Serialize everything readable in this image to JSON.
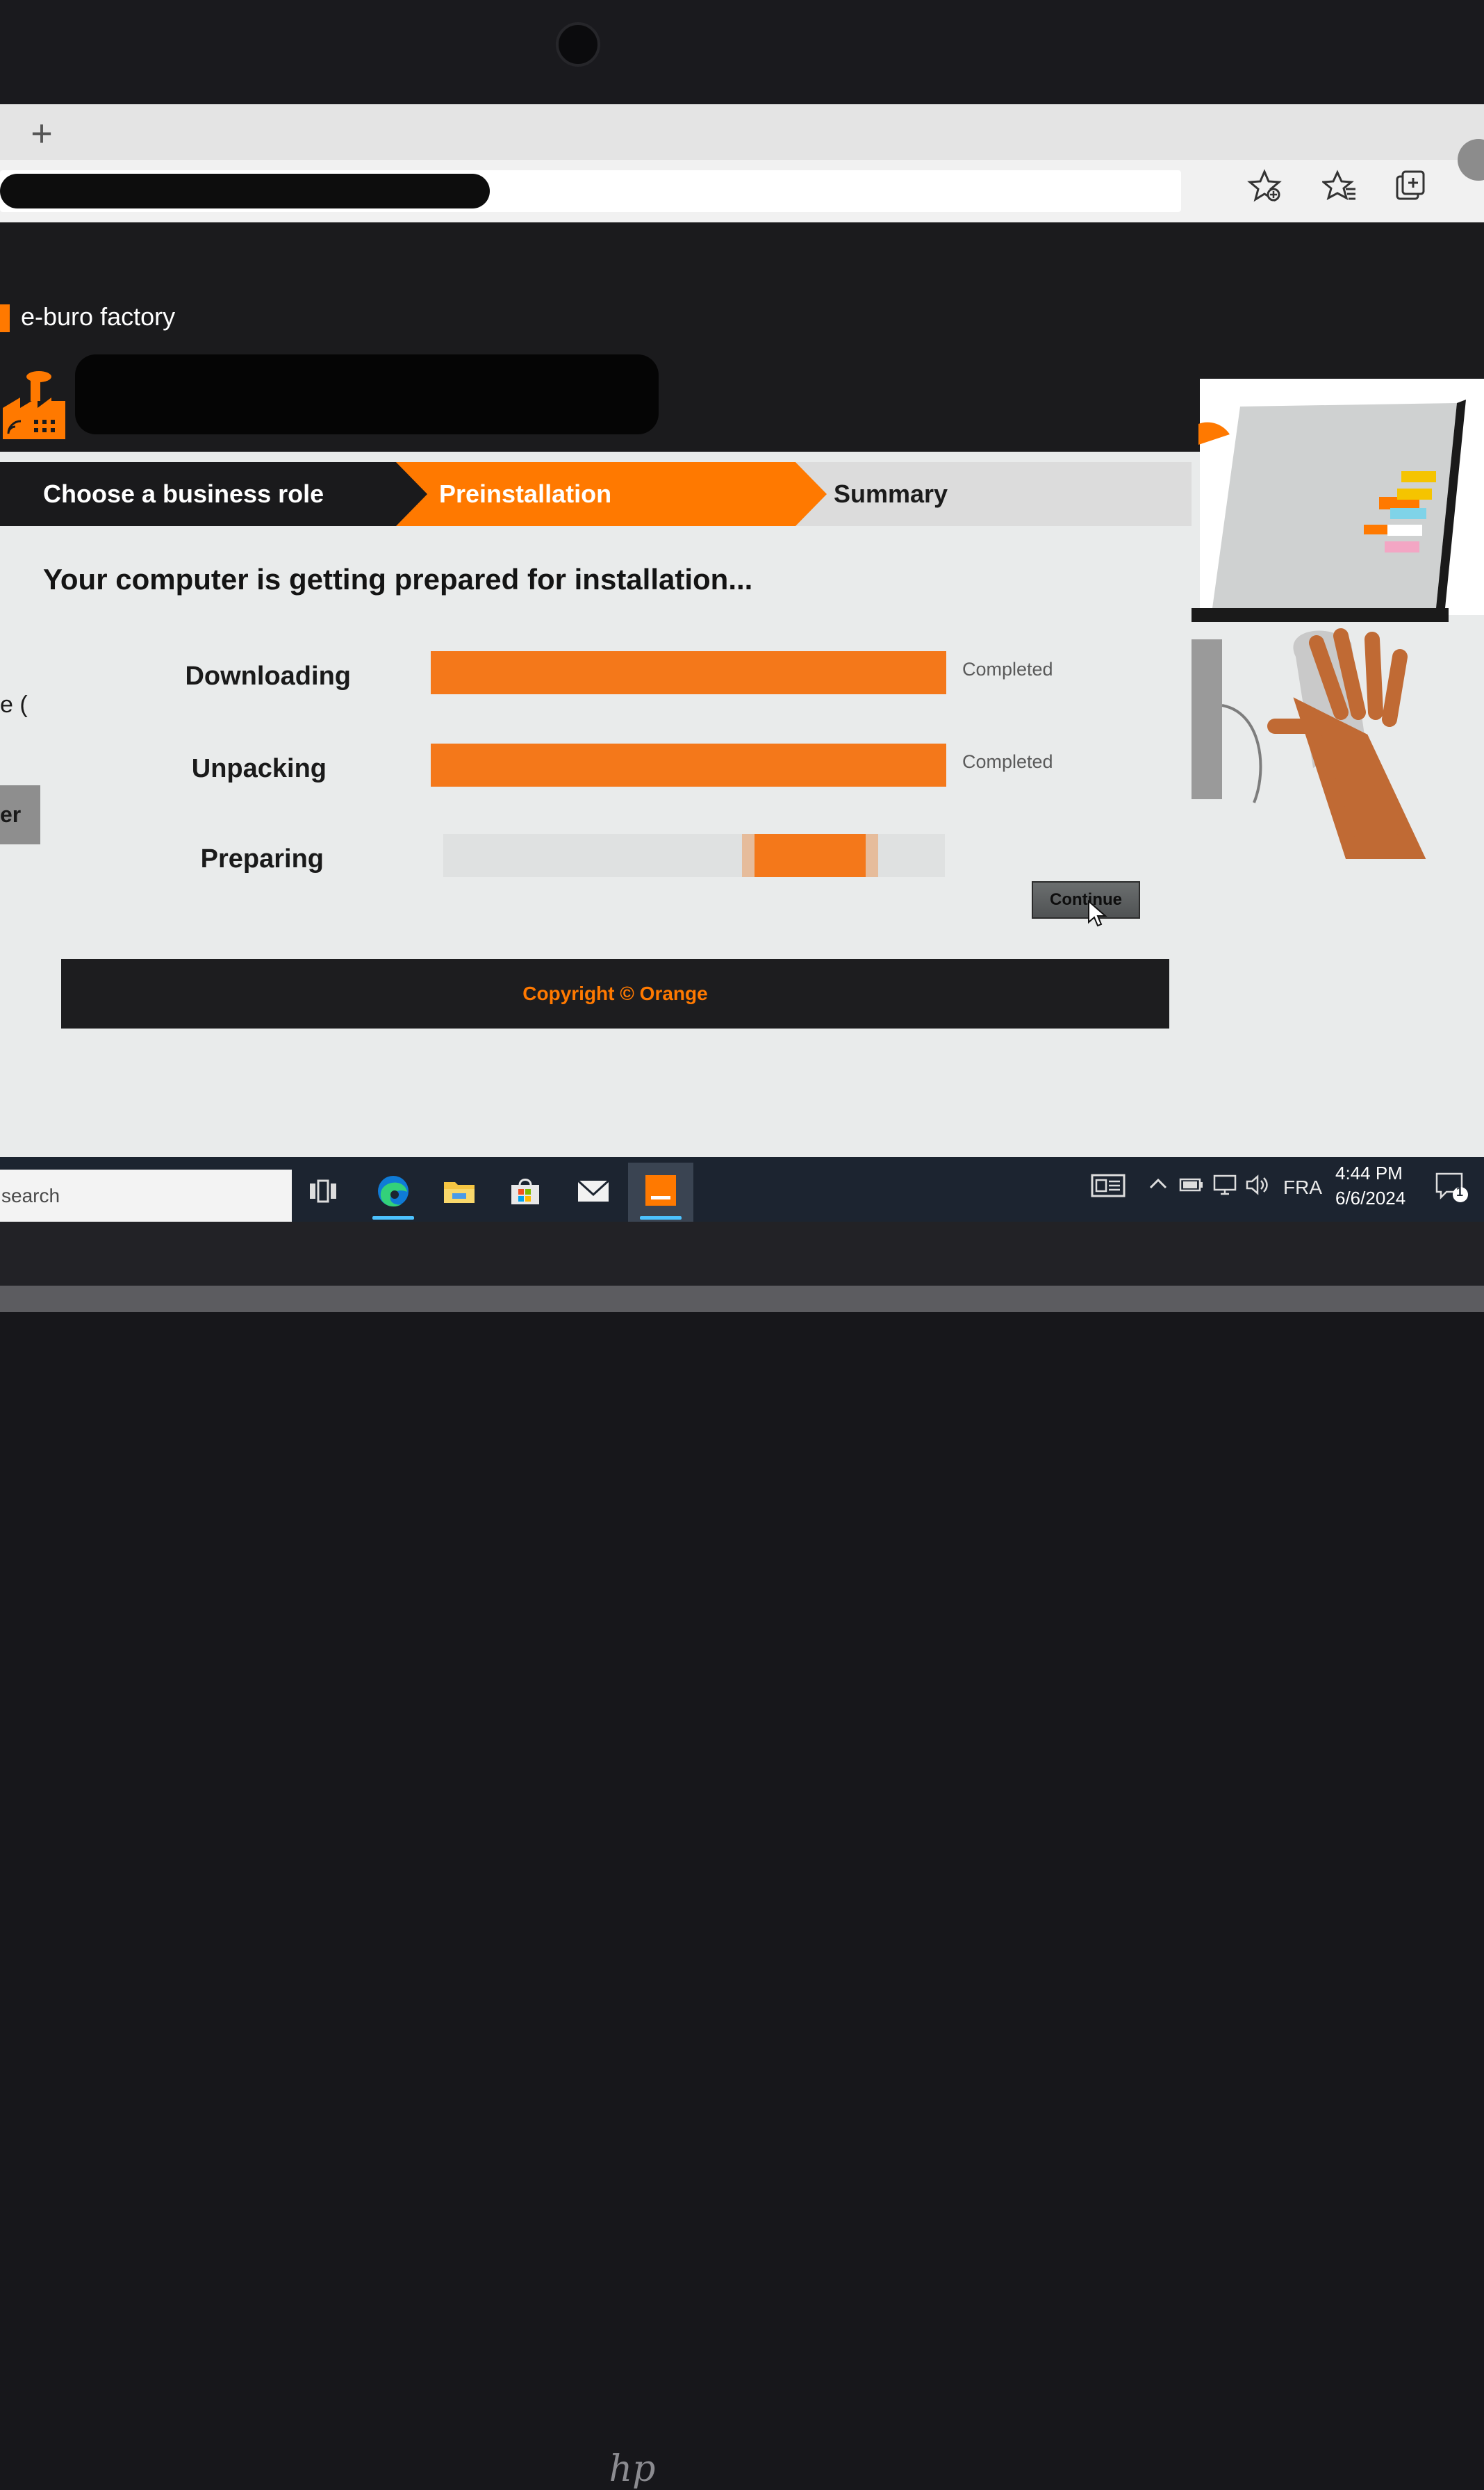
{
  "browser": {
    "new_tab_label": "+",
    "toolbar_icons": [
      "add-favorite-icon",
      "favorites-icon",
      "collections-icon",
      "profile-icon"
    ]
  },
  "app": {
    "brand_name": "e-buro factory",
    "accent_color": "#ff7900"
  },
  "steps": [
    {
      "label": "Choose a business role",
      "state": "done"
    },
    {
      "label": "Preinstallation",
      "state": "active"
    },
    {
      "label": "Summary",
      "state": "pending"
    }
  ],
  "main": {
    "heading": "Your computer is getting prepared for installation...",
    "tasks": [
      {
        "label": "Downloading",
        "status": "Completed",
        "progress": 1.0
      },
      {
        "label": "Unpacking",
        "status": "Completed",
        "progress": 1.0
      },
      {
        "label": "Preparing",
        "status": "",
        "progress": null
      }
    ],
    "continue_label": "Continue"
  },
  "footer": {
    "copyright": "Copyright © Orange"
  },
  "left_partial": {
    "text": "e (",
    "button_text": "er"
  },
  "taskbar": {
    "search_placeholder": "search",
    "apps": [
      "task-view-icon",
      "edge-icon",
      "file-explorer-icon",
      "store-icon",
      "mail-icon",
      "orange-app-icon"
    ],
    "language": "FRA",
    "time": "4:44 PM",
    "date": "6/6/2024",
    "notification_count": "1"
  }
}
